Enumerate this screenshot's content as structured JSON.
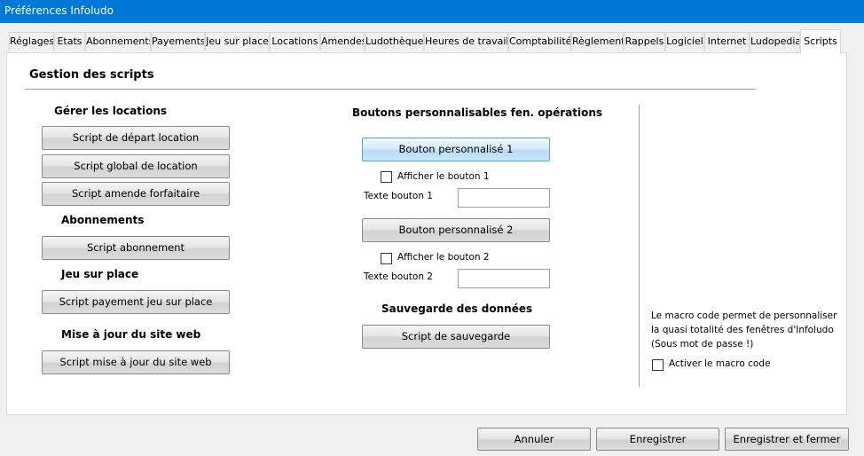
{
  "window": {
    "title": "Préférences Infoludo"
  },
  "tabs": [
    {
      "label": "Réglages"
    },
    {
      "label": "Etats"
    },
    {
      "label": "Abonnements"
    },
    {
      "label": "Payements"
    },
    {
      "label": "Jeu sur place"
    },
    {
      "label": "Locations"
    },
    {
      "label": "Amendes"
    },
    {
      "label": "Ludothèque"
    },
    {
      "label": "Heures de travail"
    },
    {
      "label": "Comptabilité"
    },
    {
      "label": "Règlement"
    },
    {
      "label": "Rappels"
    },
    {
      "label": "Logiciel"
    },
    {
      "label": "Internet"
    },
    {
      "label": "Ludopedia"
    },
    {
      "label": "Scripts"
    }
  ],
  "active_tab": "Scripts",
  "main": {
    "title": "Gestion des scripts",
    "left": {
      "locations_heading": "Gérer les locations",
      "btn_depart": "Script de départ location",
      "btn_global": "Script global de location",
      "btn_amende": "Script amende forfaitaire",
      "abonnements_heading": "Abonnements",
      "btn_abonnement": "Script abonnement",
      "jeu_heading": "Jeu sur place",
      "btn_jeu": "Script payement jeu sur place",
      "site_heading": "Mise à jour du site web",
      "btn_site": "Script mise à jour du site web"
    },
    "middle": {
      "heading": "Boutons personnalisables fen. opérations",
      "btn1": "Bouton personnalisé 1",
      "show1": "Afficher le bouton 1",
      "text1_label": "Texte bouton 1",
      "text1_value": "",
      "btn2": "Bouton personnalisé 2",
      "show2": "Afficher le bouton 2",
      "text2_label": "Texte bouton 2",
      "text2_value": "",
      "backup_heading": "Sauvegarde des données",
      "btn_backup": "Script de sauvegarde"
    },
    "right": {
      "macro_line1": "Le macro code permet de personnaliser",
      "macro_line2": "la quasi totalité des fenêtres d'Infoludo",
      "macro_line3": "(Sous  mot de passe !)",
      "macro_checkbox": "Activer le macro code"
    }
  },
  "footer": {
    "cancel": "Annuler",
    "save": "Enregistrer",
    "save_close": "Enregistrer et fermer"
  }
}
